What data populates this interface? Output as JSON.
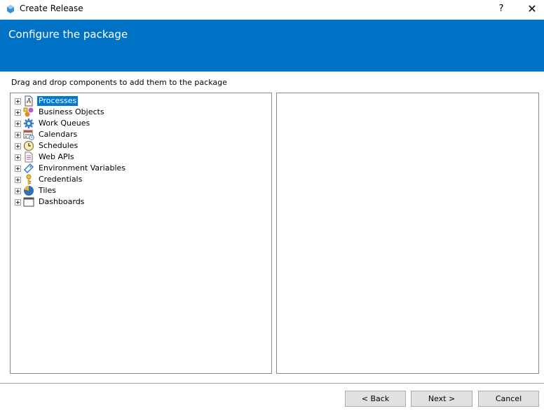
{
  "window": {
    "title": "Create Release",
    "help": "?",
    "close": "✕"
  },
  "banner": {
    "title": "Configure the package",
    "color": "#0072c6"
  },
  "instructions": "Drag and drop components to add them to the package",
  "tree": {
    "items": [
      {
        "label": "Processes",
        "icon": "process-icon",
        "selected": true
      },
      {
        "label": "Business Objects",
        "icon": "business-object-icon"
      },
      {
        "label": "Work Queues",
        "icon": "gear-icon"
      },
      {
        "label": "Calendars",
        "icon": "calendar-icon"
      },
      {
        "label": "Schedules",
        "icon": "clock-icon"
      },
      {
        "label": "Web APIs",
        "icon": "document-icon"
      },
      {
        "label": "Environment Variables",
        "icon": "tag-icon"
      },
      {
        "label": "Credentials",
        "icon": "key-icon"
      },
      {
        "label": "Tiles",
        "icon": "pie-chart-icon"
      },
      {
        "label": "Dashboards",
        "icon": "window-icon"
      }
    ]
  },
  "buttons": {
    "back": "< Back",
    "next": "Next >",
    "cancel": "Cancel"
  }
}
